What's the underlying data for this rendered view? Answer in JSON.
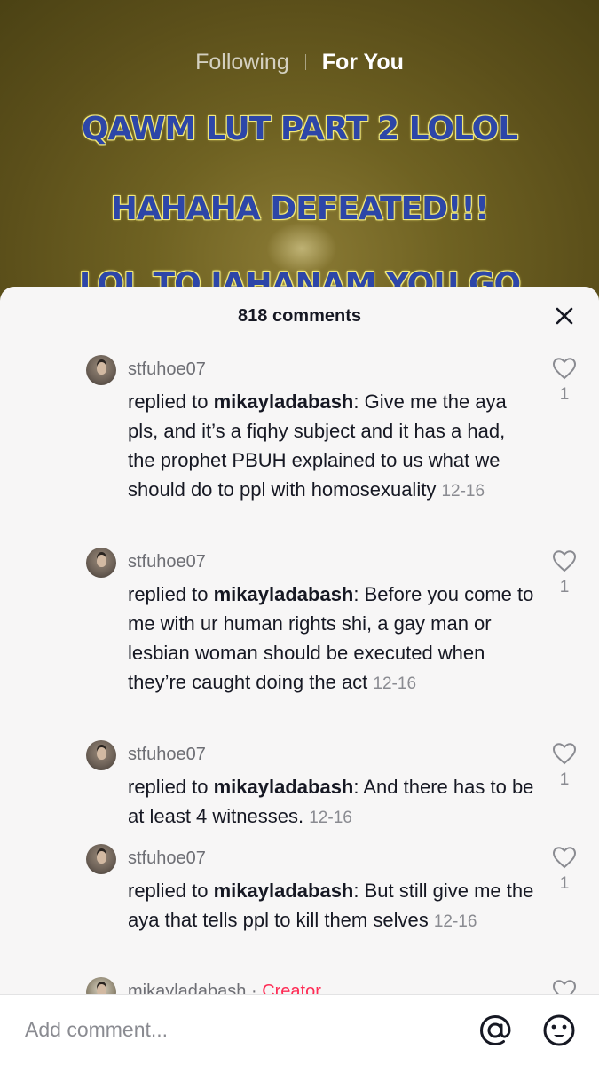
{
  "nav": {
    "following": "Following",
    "for_you": "For You"
  },
  "video": {
    "caption_lines": [
      "QAWM LUT PART 2 LOLOL",
      "HAHAHA DEFEATED!!!",
      "LOL TO JAHANAM YOU GO"
    ]
  },
  "sheet": {
    "title": "818 comments"
  },
  "comments": [
    {
      "username": "stfuhoe07",
      "reply_prefix": "replied to ",
      "reply_to": "mikayladabash",
      "text": ": Give me the aya pls, and it’s a fiqhy subject and it has a had, the prophet PBUH explained to us what we should do to ppl with homosexuality",
      "date": "12-16",
      "likes": "1"
    },
    {
      "username": "stfuhoe07",
      "reply_prefix": "replied to ",
      "reply_to": "mikayladabash",
      "text": ": Before you come to me with ur human rights shi, a gay man or lesbian woman should be executed when they’re caught doing the act",
      "date": "12-16",
      "likes": "1"
    },
    {
      "username": "stfuhoe07",
      "reply_prefix": "replied to ",
      "reply_to": "mikayladabash",
      "text": ": And there has to be at least 4 witnesses.",
      "date": "12-16",
      "likes": "1"
    },
    {
      "username": "stfuhoe07",
      "reply_prefix": "replied to ",
      "reply_to": "mikayladabash",
      "text": ": But still give me the aya that tells ppl to kill them selves",
      "date": "12-16",
      "likes": "1"
    }
  ],
  "partial_comment": {
    "username": "mikayladabash",
    "separator": " · ",
    "badge": "Creator"
  },
  "input": {
    "placeholder": "Add comment..."
  },
  "colors": {
    "accent": "#fe2c55",
    "text": "#161823",
    "muted": "#8a8b91"
  },
  "icons": [
    "close-icon",
    "heart-icon",
    "at-icon",
    "emoji-icon"
  ]
}
